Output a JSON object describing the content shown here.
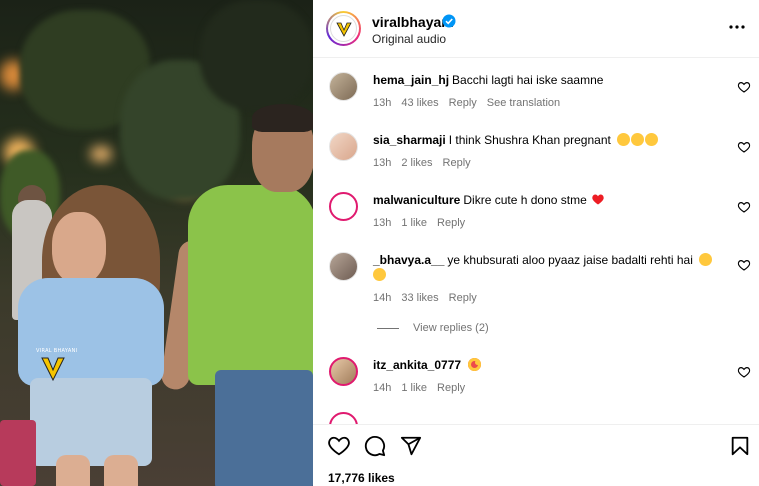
{
  "post": {
    "username": "viralbhayani",
    "subtitle": "Original audio",
    "watermark_text": "VIRAL BHAYANI"
  },
  "comments": [
    {
      "user": "hema_jain_hj",
      "text": "Bacchi lagti hai iske saamne",
      "time": "13h",
      "likes": "43 likes",
      "reply": "Reply",
      "translate": "See translation",
      "emojis": []
    },
    {
      "user": "sia_sharmaji",
      "text": "I think Shushra Khan pregnant",
      "time": "13h",
      "likes": "2 likes",
      "reply": "Reply",
      "emojis": [
        "thinking-face",
        "thinking-face",
        "thinking-face"
      ]
    },
    {
      "user": "malwaniculture",
      "text": "Dikre cute h dono stme",
      "time": "13h",
      "likes": "1 like",
      "reply": "Reply",
      "emojis": [
        "red-heart"
      ]
    },
    {
      "user": "_bhavya.a__",
      "text": "ye khubsurati aloo pyaaz jaise badalti rehti hai",
      "time": "14h",
      "likes": "33 likes",
      "reply": "Reply",
      "emojis": [
        "laughing-face",
        "laughing-face"
      ]
    },
    {
      "user": "itz_ankita_0777",
      "text": "",
      "time": "14h",
      "likes": "1 like",
      "reply": "Reply",
      "emojis": [
        "heart-eyes-face"
      ]
    }
  ],
  "view_replies": "View replies (2)",
  "footer": {
    "likes_count": "17,776 likes"
  },
  "colors": {
    "verified": "#0095f6",
    "meta_text": "#737373",
    "heart_red": "#ed1d24",
    "emoji_yellow": "#ffc83d",
    "story_ring": "#e01a6f"
  }
}
